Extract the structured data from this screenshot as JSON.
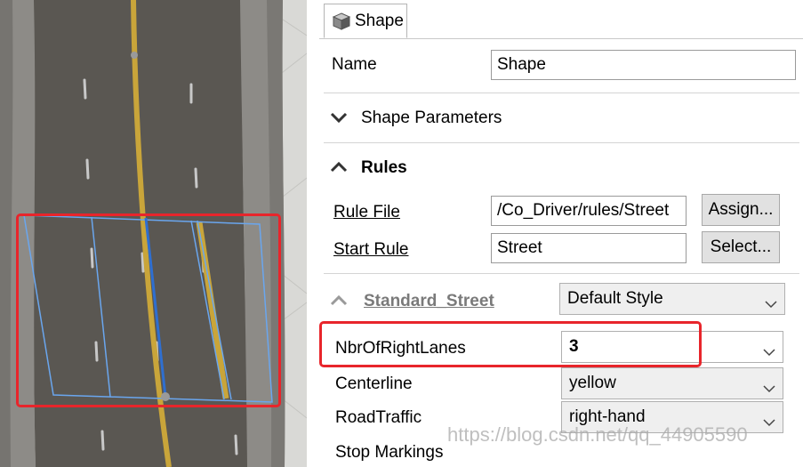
{
  "tab": {
    "label": "Shape",
    "icon": "cube-icon"
  },
  "name_row": {
    "label": "Name",
    "value": "Shape"
  },
  "shape_parameters": {
    "title": "Shape Parameters",
    "icon": "chevron-down-icon"
  },
  "rules": {
    "title": "Rules",
    "icon": "chevron-up-icon",
    "rule_file": {
      "label": "Rule File",
      "value": "/Co_Driver/rules/Street",
      "button": "Assign..."
    },
    "start_rule": {
      "label": "Start Rule",
      "value": "Street",
      "button": "Select..."
    }
  },
  "standard_street": {
    "title": "Standard_Street",
    "icon": "chevron-up-icon",
    "style": "Default Style",
    "attributes": [
      {
        "label": "NbrOfRightLanes",
        "value": "3"
      },
      {
        "label": "Centerline",
        "value": "yellow"
      },
      {
        "label": "RoadTraffic",
        "value": "right-hand"
      },
      {
        "label": "Stop Markings",
        "value": ""
      }
    ]
  },
  "watermark": "https://blog.csdn.net/qq_44905590",
  "colors": {
    "highlight": "#e8252b",
    "selection": "#3a7fd6",
    "road": "#5a5752",
    "centerline": "#c9a53a"
  }
}
